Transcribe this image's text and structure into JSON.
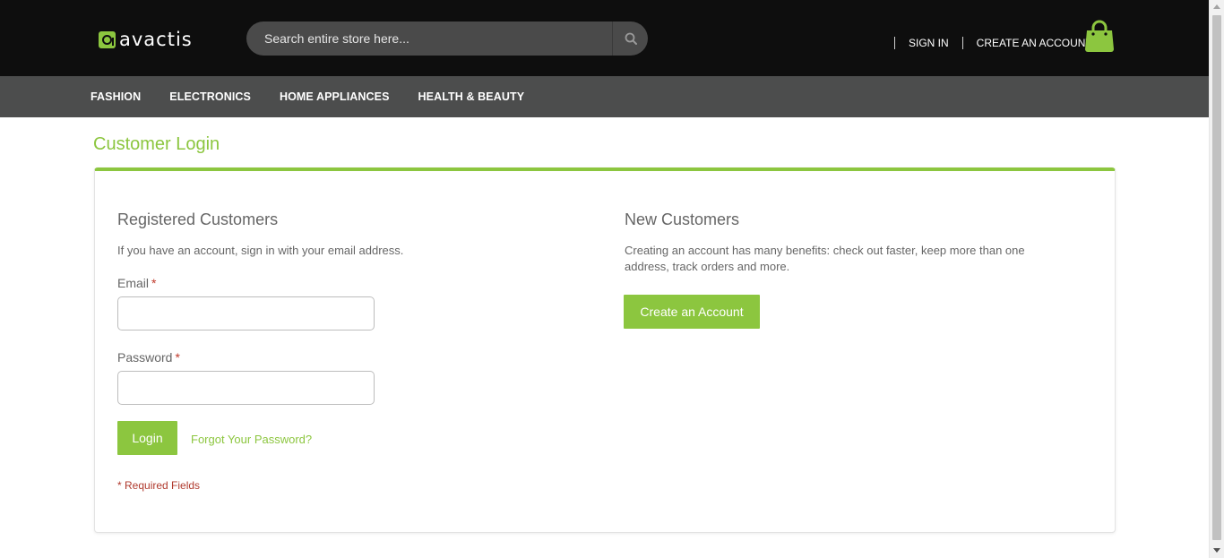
{
  "header": {
    "logo_text": "avactis",
    "search": {
      "placeholder": "Search entire store here...",
      "value": ""
    },
    "links": {
      "sign_in": "SIGN IN",
      "create_account": "CREATE AN ACCOUNT"
    },
    "icons": {
      "search": "search-icon",
      "cart": "shopping-bag-icon",
      "logo": "logo-mark-icon"
    }
  },
  "nav": {
    "items": [
      {
        "label": "FASHION"
      },
      {
        "label": "ELECTRONICS"
      },
      {
        "label": "HOME APPLIANCES"
      },
      {
        "label": "HEALTH & BEAUTY"
      }
    ]
  },
  "main": {
    "page_title": "Customer Login",
    "registered": {
      "title": "Registered Customers",
      "description": "If you have an account, sign in with your email address.",
      "email_label": "Email",
      "email_value": "",
      "password_label": "Password",
      "password_value": "",
      "required_marker": "*",
      "login_button": "Login",
      "forgot_link": "Forgot Your Password?",
      "required_note": "* Required Fields"
    },
    "new_customers": {
      "title": "New Customers",
      "description_line1": "Creating an account has many benefits: check out faster, keep more than one",
      "description_line2": "address, track orders and more.",
      "create_button": "Create an Account"
    }
  },
  "colors": {
    "accent": "#8cc63f",
    "header_bg": "#0e0e0e",
    "nav_bg": "#4c4d4d",
    "required": "#c0392b"
  }
}
